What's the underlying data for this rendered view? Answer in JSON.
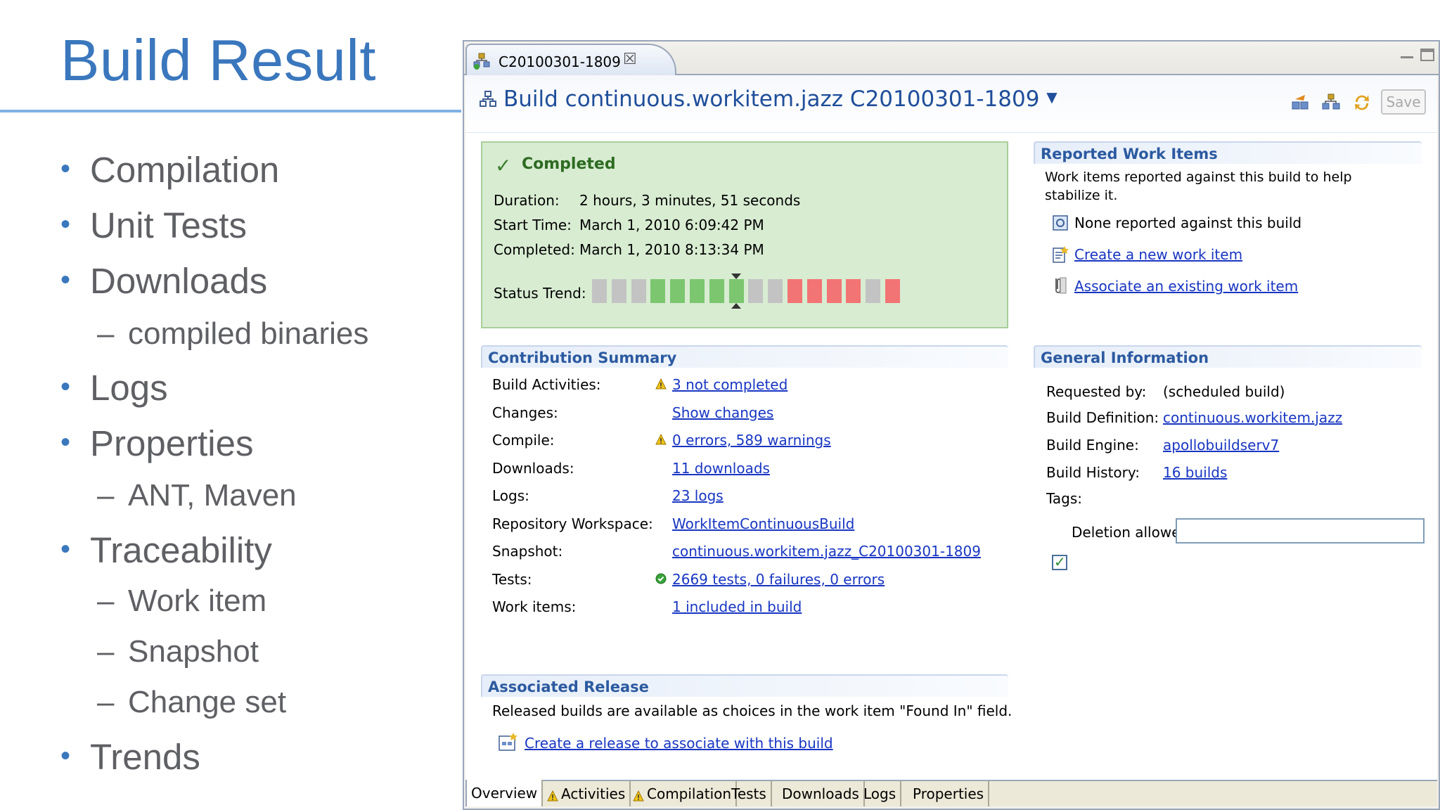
{
  "slide": {
    "title": "Build Result",
    "bullets": [
      {
        "text": "Compilation",
        "level": 1
      },
      {
        "text": "Unit Tests",
        "level": 1
      },
      {
        "text": "Downloads",
        "level": 1
      },
      {
        "text": "compiled binaries",
        "level": 2
      },
      {
        "text": "Logs",
        "level": 1
      },
      {
        "text": "Properties",
        "level": 1
      },
      {
        "text": "ANT, Maven",
        "level": 2
      },
      {
        "text": "Traceability",
        "level": 1
      },
      {
        "text": "Work item",
        "level": 2
      },
      {
        "text": "Snapshot",
        "level": 2
      },
      {
        "text": "Change set",
        "level": 2
      },
      {
        "text": "Trends",
        "level": 1
      }
    ],
    "bullet_glyph": "•",
    "sub_glyph": "–"
  },
  "editor": {
    "tab_label": "C20100301-1809",
    "title": "Build continuous.workitem.jazz C20100301-1809",
    "save_label": "Save",
    "completed": {
      "state": "Completed",
      "duration_label": "Duration:",
      "duration": "2 hours, 3 minutes, 51 seconds",
      "start_label": "Start Time:",
      "start": "March 1, 2010 6:09:42 PM",
      "completed_label": "Completed:",
      "completed_value": "March 1, 2010 8:13:34 PM",
      "trend_label": "Status Trend:",
      "trend": [
        "gray",
        "gray",
        "gray",
        "green",
        "green",
        "green",
        "green",
        "green",
        "gray",
        "gray",
        "red",
        "red",
        "red",
        "red",
        "gray",
        "red"
      ],
      "trend_current_index": 7
    },
    "reported": {
      "heading": "Reported Work Items",
      "description": "Work items reported against this build to help stabilize it.",
      "none": "None reported against this build",
      "create": "Create a new work item",
      "associate": "Associate an existing work item"
    },
    "contribution": {
      "heading": "Contribution Summary",
      "rows": [
        {
          "label": "Build Activities:",
          "value": "3 not completed",
          "status": "warn"
        },
        {
          "label": "Changes:",
          "value": "Show changes",
          "status": ""
        },
        {
          "label": "Compile:",
          "value": "0 errors, 589 warnings",
          "status": "warn"
        },
        {
          "label": "Downloads:",
          "value": "11 downloads",
          "status": ""
        },
        {
          "label": "Logs:",
          "value": "23 logs",
          "status": ""
        },
        {
          "label": "Repository Workspace:",
          "value": "WorkItemContinuousBuild",
          "status": ""
        },
        {
          "label": "Snapshot:",
          "value": "continuous.workitem.jazz_C20100301-1809",
          "status": ""
        },
        {
          "label": "Tests:",
          "value": "2669 tests, 0 failures, 0 errors",
          "status": "ok"
        },
        {
          "label": "Work items:",
          "value": "1 included in build",
          "status": ""
        }
      ]
    },
    "general": {
      "heading": "General Information",
      "requested_label": "Requested by:",
      "requested": "(scheduled build)",
      "definition_label": "Build Definition:",
      "definition": "continuous.workitem.jazz",
      "engine_label": "Build Engine:",
      "engine": "apollobuildserv7",
      "history_label": "Build History:",
      "history": "16 builds",
      "tags_label": "Tags:",
      "tags_value": "",
      "deletion_label": "Deletion allowed",
      "deletion_checked": true
    },
    "release": {
      "heading": "Associated Release",
      "description": "Released builds are available as choices in the work item \"Found In\" field.",
      "create": "Create a release to associate with this build"
    },
    "bottom_tabs": [
      {
        "label": "Overview",
        "warn": false,
        "active": true
      },
      {
        "label": "Activities",
        "warn": true,
        "active": false
      },
      {
        "label": "Compilation",
        "warn": true,
        "active": false
      },
      {
        "label": "Tests",
        "warn": false,
        "active": false
      },
      {
        "label": "Downloads",
        "warn": false,
        "active": false
      },
      {
        "label": "Logs",
        "warn": false,
        "active": false
      },
      {
        "label": "Properties",
        "warn": false,
        "active": false
      }
    ],
    "colors": {
      "trend_green": "#7cc66f",
      "trend_red": "#f27474",
      "trend_gray": "#c3c3c3",
      "link": "#1836c2",
      "heading": "#2c5aa0"
    }
  }
}
